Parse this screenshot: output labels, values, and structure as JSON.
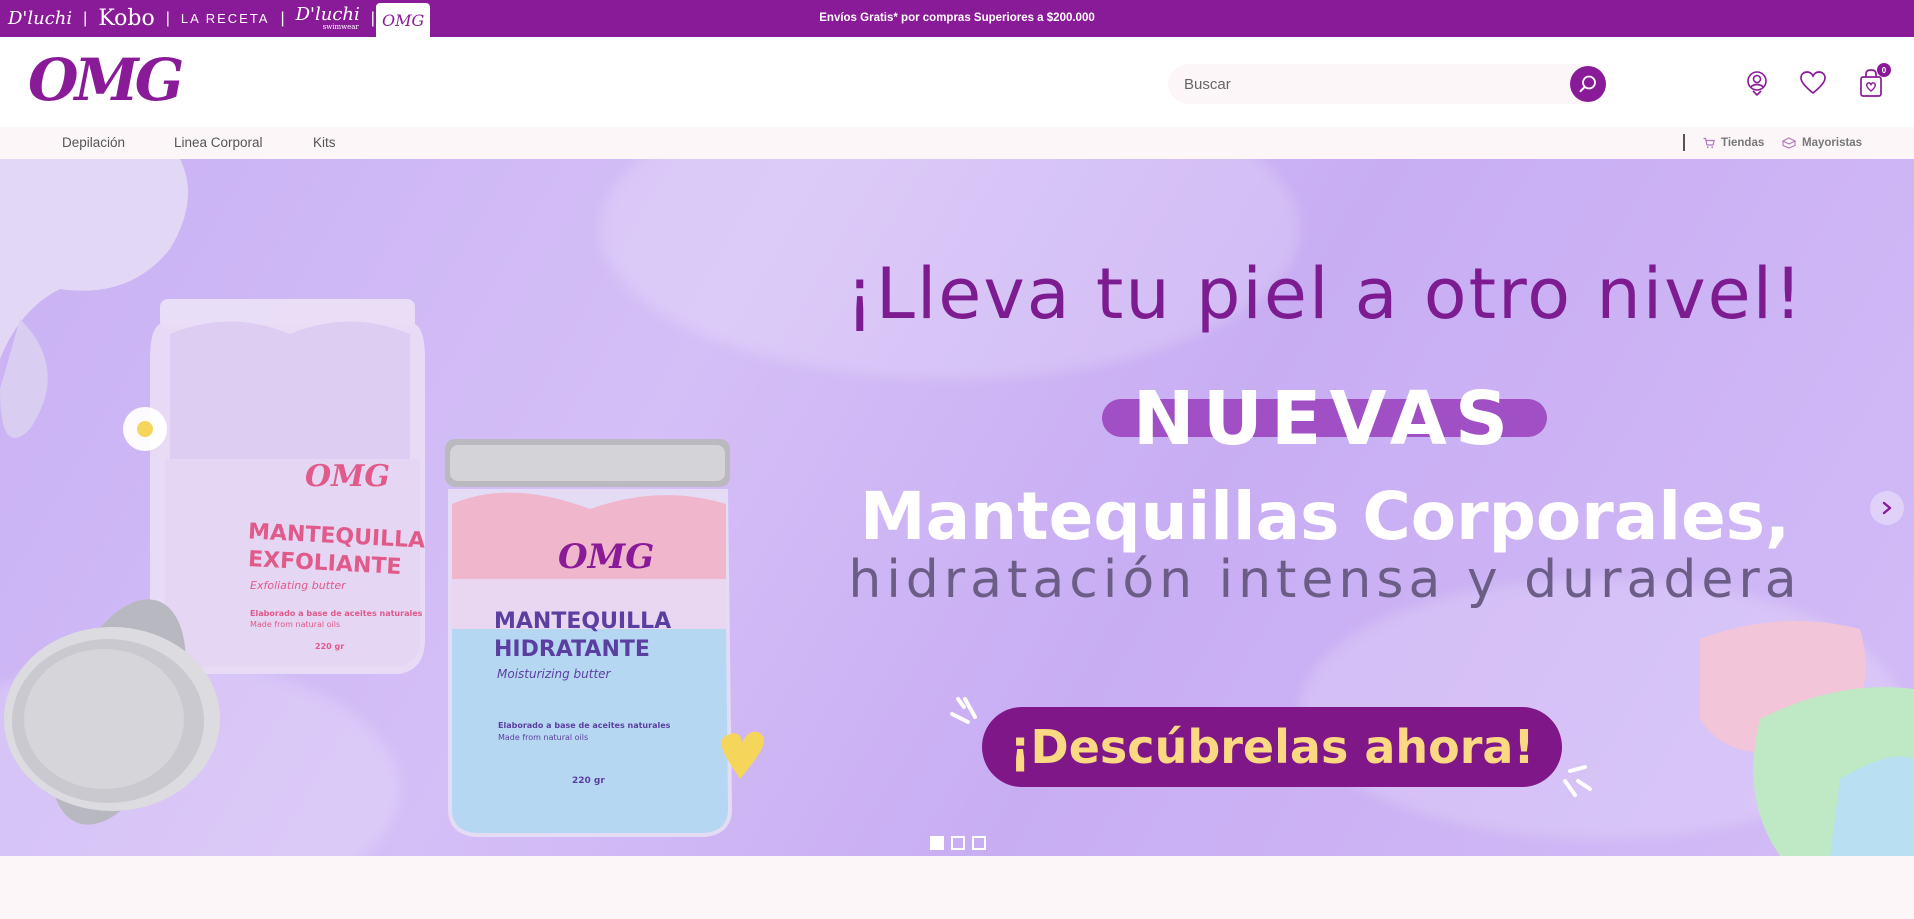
{
  "brand_bar": {
    "brands": [
      {
        "label": "D'luchi"
      },
      {
        "label": "Kobo"
      },
      {
        "label": "LA RECETA"
      },
      {
        "label": "D'luchi",
        "sub": "swimwear"
      },
      {
        "label": "OMG"
      }
    ],
    "separator": "|",
    "promo": "Envíos Gratis* por compras Superiores a $200.000"
  },
  "header": {
    "logo": "OMG",
    "search_placeholder": "Buscar",
    "cart_count": "0"
  },
  "nav": {
    "categories": [
      "Depilación",
      "Linea Corporal",
      "Kits"
    ],
    "links": [
      "Tiendas",
      "Mayoristas"
    ]
  },
  "hero": {
    "headline": "¡Lleva tu piel a otro nivel!",
    "badge": "NUEVAS",
    "title": "Mantequillas Corporales,",
    "subtitle": "hidratación intensa y duradera",
    "cta": "¡Descúbrelas ahora!",
    "jar1": {
      "brand": "OMG",
      "line1": "MANTEQUILLA",
      "line2": "EXFOLIANTE",
      "en": "Exfoliating butter",
      "es_note": "Elaborado a base de aceites naturales",
      "en_note": "Made from natural oils",
      "weight": "220 gr"
    },
    "jar2": {
      "brand": "OMG",
      "line1": "MANTEQUILLA",
      "line2": "HIDRATANTE",
      "en": "Moisturizing butter",
      "es_note": "Elaborado a base de aceites naturales",
      "en_note": "Made from natural oils",
      "weight": "220 gr"
    },
    "slides_total": 3,
    "active_slide": 1
  },
  "colors": {
    "brand_purple": "#8a1b98",
    "hero_bg": "#cbb3f5",
    "cta_text": "#fbd882",
    "page_bg": "#fdf6f8"
  },
  "icons": [
    "search-icon",
    "user-icon",
    "heart-icon",
    "shopping-bag-icon",
    "cart-icon",
    "box-icon",
    "chevron-right-icon"
  ]
}
